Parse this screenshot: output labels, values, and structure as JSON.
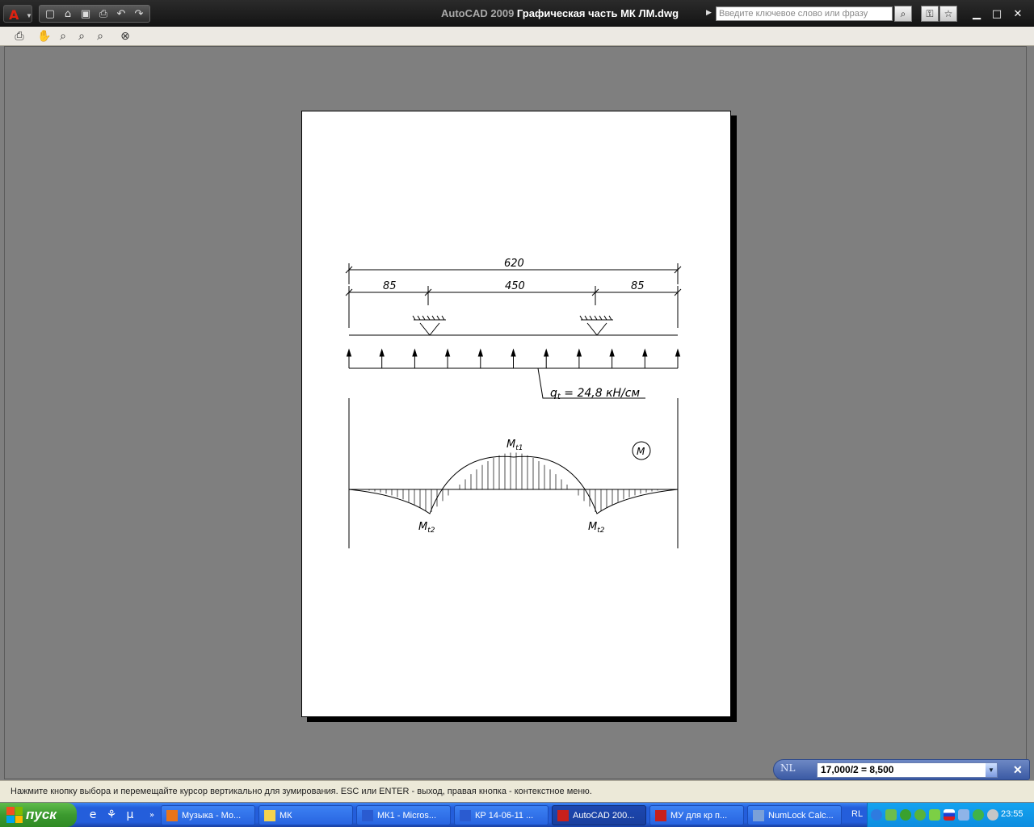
{
  "window": {
    "title_app": "AutoCAD 2009",
    "title_file": "Графическая часть МК ЛМ.dwg",
    "search_placeholder": "Введите ключевое слово или фразу"
  },
  "drawing": {
    "dim_total": "620",
    "dim_left": "85",
    "dim_mid": "450",
    "dim_right": "85",
    "load_label_q": "q",
    "load_label_sub": "t",
    "load_label_rest": " = 24,8 кН/см",
    "mt1_main": "M",
    "mt1_sub": "t1",
    "mt2_main": "M",
    "mt2_sub": "t2",
    "diagram_symbol": "M"
  },
  "calculator": {
    "mode": "NL",
    "expression": "17,000/2 = 8,500"
  },
  "status": {
    "message": "Нажмите кнопку выбора и перемещайте курсор вертикально для зумирования. ESC или ENTER - выход, правая кнопка - контекстное меню."
  },
  "taskbar": {
    "start_label": "пуск",
    "tasks": [
      {
        "label": "Музыка - Mo...",
        "icon": "firefox-icon",
        "color": "#e8741a"
      },
      {
        "label": "МК",
        "icon": "folder-icon",
        "color": "#f4d34e"
      },
      {
        "label": "МК1 - Micros...",
        "icon": "word-icon",
        "color": "#2a5bd0"
      },
      {
        "label": "КР 14-06-11 ...",
        "icon": "word-icon",
        "color": "#2a5bd0"
      },
      {
        "label": "AutoCAD 200...",
        "icon": "autocad-icon",
        "color": "#c8201c"
      },
      {
        "label": "МУ для кр п...",
        "icon": "pdf-icon",
        "color": "#c8201c"
      },
      {
        "label": "NumLock Calc...",
        "icon": "calculator-icon",
        "color": "#7aa0d8"
      }
    ],
    "language": "RL",
    "clock": "23:55"
  }
}
